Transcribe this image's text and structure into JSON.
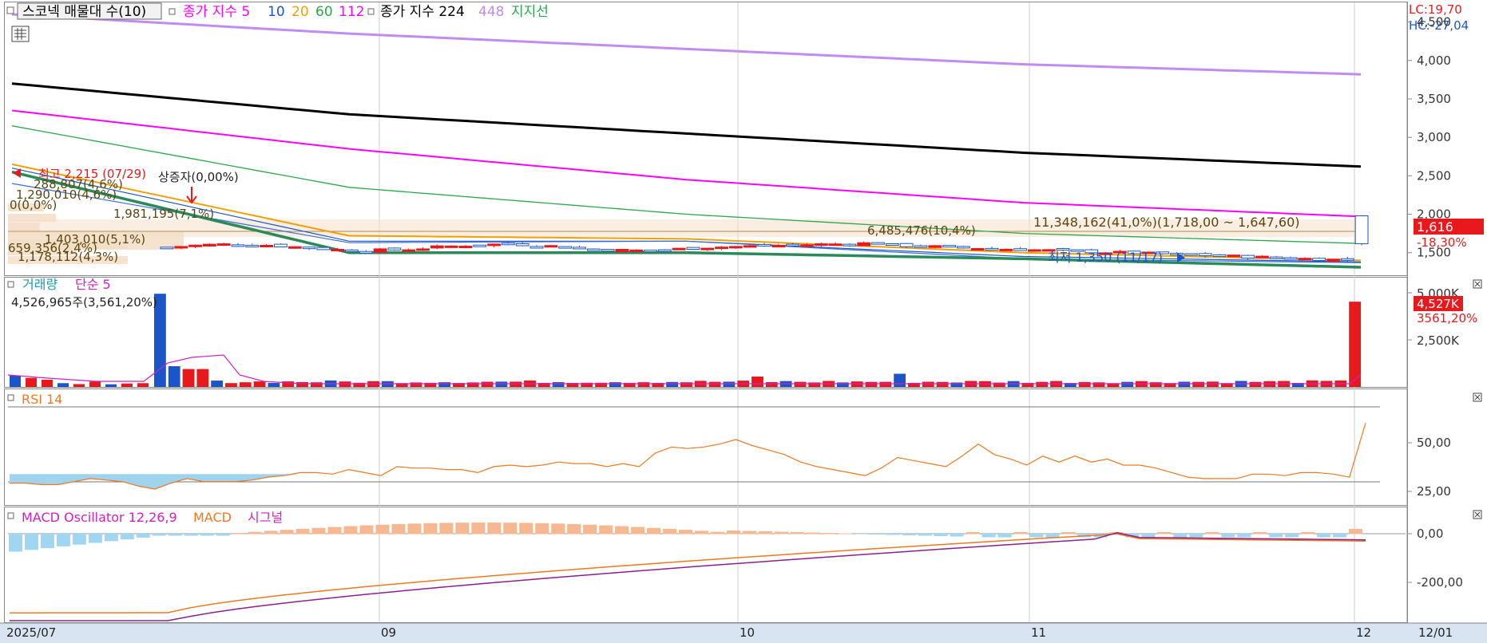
{
  "legend": {
    "main_title": "스코넥 매물대 수(10)",
    "ma_label": "종가 지수 5",
    "ma10": "10",
    "ma20": "20",
    "ma60": "60",
    "ma112": "112",
    "ma224_label": "종가 지수 224",
    "ma448": "448",
    "support_label": "지지선"
  },
  "price_panel": {
    "lc": "LC:19,70",
    "hc": "HC:-27,04",
    "axis_ticks": [
      "4,500",
      "4,000",
      "3,500",
      "3,000",
      "2,500",
      "2,000",
      "1,500"
    ],
    "current_price": "1,616",
    "change_pct": "-18,30%",
    "high_label": "최고 2,215 (07/29)",
    "low_label": "최저 1,350 (11/17)",
    "cap_label": "상증자(0,00%)",
    "profile_labels": {
      "p1": "288,807(4,6%)",
      "p2": "1,290,010(4,6%)",
      "p3": "0(0,0%)",
      "p4": "1,981,195(7,1%)",
      "p5": "1,403,010(5,1%)",
      "p6": "659,356(2,4%)",
      "p7": "1,178,112(4,3%)",
      "p8": "6,485,476(10,4%)",
      "max": "11,348,162(41,0%)(1,718,00 ~ 1,647,60)"
    }
  },
  "volume_panel": {
    "title": "거래량",
    "ma_label": "단순 5",
    "info": "4,526,965주(3,561,20%)",
    "axis_ticks": [
      "5,000K",
      "2,500K"
    ],
    "current": "4,527K",
    "change_pct": "3561,20%"
  },
  "rsi_panel": {
    "title": "RSI 14",
    "axis_ticks": [
      "50,00",
      "25,00"
    ]
  },
  "macd_panel": {
    "title": "MACD Oscillator 12,26,9",
    "macd_label": "MACD",
    "signal_label": "시그널",
    "axis_ticks": [
      "0,00",
      "-200,00"
    ]
  },
  "x_axis": {
    "labels": [
      "2025/07",
      "09",
      "10",
      "11",
      "12"
    ],
    "right_label": "12/01"
  },
  "colors": {
    "up": "#e8191c",
    "down": "#1a56c9",
    "ma5": "#1a56c9",
    "ma10": "#ff00ff",
    "ma20": "#f0a000",
    "ma60": "#2aa84a",
    "ma224": "#000000",
    "ma448": "#c08cf0",
    "support": "#2a8a5a",
    "rsi": "#f07820",
    "volume_ma": "#d020c0"
  },
  "chart_data": [
    {
      "type": "line",
      "title": "스코넥",
      "ylim": [
        1300,
        4600
      ],
      "x": [
        "2025/07",
        "09",
        "10",
        "11",
        "12"
      ],
      "series": [
        {
          "name": "448",
          "values": [
            4600,
            4350,
            4150,
            3950,
            3820
          ]
        },
        {
          "name": "종가 지수 224",
          "values": [
            3700,
            3300,
            3050,
            2800,
            2620
          ]
        },
        {
          "name": "112",
          "values": [
            3350,
            2850,
            2450,
            2150,
            1970
          ]
        },
        {
          "name": "60",
          "values": [
            3150,
            2350,
            2000,
            1750,
            1620
          ]
        },
        {
          "name": "20",
          "values": [
            2650,
            1720,
            1680,
            1500,
            1400
          ]
        },
        {
          "name": "10",
          "values": [
            2600,
            1650,
            1650,
            1450,
            1380
          ]
        },
        {
          "name": "5",
          "values": [
            2400,
            1630,
            1650,
            1420,
            1370
          ]
        },
        {
          "name": "지지선",
          "values": [
            2550,
            1500,
            1500,
            1420,
            1310
          ]
        }
      ],
      "annotations": {
        "high": 2215,
        "low": 1350,
        "last": 1616
      }
    },
    {
      "type": "bar",
      "title": "거래량",
      "ylim": [
        0,
        5000
      ],
      "last": 4527
    },
    {
      "type": "line",
      "title": "RSI 14",
      "ylim": [
        10,
        80
      ],
      "values": [
        24,
        24,
        23,
        23,
        25,
        27,
        26,
        25,
        22,
        20,
        24,
        27,
        25,
        25,
        25,
        26,
        28,
        29,
        31,
        31,
        30,
        33,
        31,
        29,
        35,
        34,
        34,
        33,
        33,
        31,
        35,
        36,
        35,
        36,
        38,
        37,
        37,
        35,
        37,
        35,
        44,
        48,
        47,
        48,
        50,
        53,
        49,
        46,
        43,
        38,
        35,
        33,
        31,
        29,
        34,
        41,
        39,
        37,
        35,
        42,
        50,
        43,
        40,
        36,
        42,
        38,
        42,
        38,
        40,
        36,
        36,
        34,
        31,
        28,
        27,
        27,
        27,
        30,
        30,
        29,
        31,
        31,
        30,
        28,
        64
      ]
    },
    {
      "type": "line",
      "title": "MACD Oscillator 12,26,9",
      "ylim": [
        -330,
        60
      ]
    }
  ]
}
